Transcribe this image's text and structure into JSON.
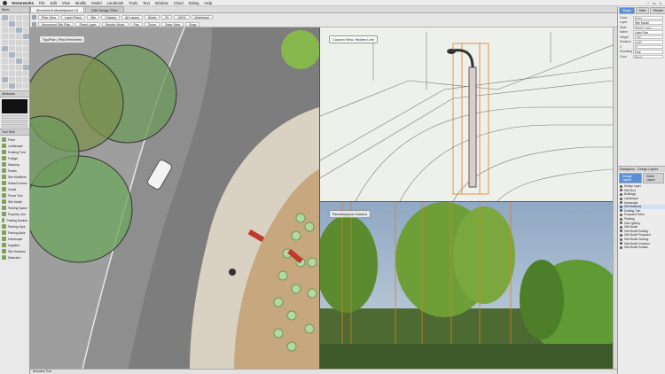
{
  "menu": {
    "app": "Vectorworks",
    "items": [
      "File",
      "Edit",
      "View",
      "Modify",
      "Model",
      "Landmark",
      "Tools",
      "Text",
      "Window",
      "Cloud",
      "Dialog",
      "Help"
    ]
  },
  "tabs": [
    {
      "label": "Monument Marketplace v4"
    },
    {
      "label": "Site Design Plan"
    }
  ],
  "viewbar": {
    "row1": [
      "Plan View",
      "Layer Plane",
      "Site",
      "Classes",
      "All Layers",
      "Sheet",
      "Fit",
      "100%",
      "Wireframe"
    ],
    "row2": [
      "Monument Site Plan",
      "Sheet Layer",
      "Render Mode",
      "Pan",
      "Zoom",
      "Save View",
      "Snap"
    ]
  },
  "tools_palette": {
    "title": "Basic",
    "attributes_title": "Attributes",
    "toolsets_title": "Tool Sets",
    "toolset_items": [
      "Plant",
      "Landscape",
      "Existing Tree",
      "Foliage",
      "Massing",
      "Roads",
      "Site Modifiers",
      "Stake/Contour",
      "Grade",
      "Fence Tool",
      "Site Model",
      "Parking Space",
      "Property Line",
      "Parking Module",
      "Parking Spot",
      "Parking Aisle",
      "Hardscape",
      "Irrigation",
      "Site Sections",
      "Detection"
    ]
  },
  "viewports": {
    "plan_label": "Top/Plan, Plan Rendered",
    "wire_label": "Custom View, Hidden Line",
    "render_label": "Renderworks Camera"
  },
  "object_info": {
    "tabs": [
      "Shape",
      "Data",
      "Render"
    ],
    "fields": [
      {
        "k": "Class",
        "v": "None"
      },
      {
        "k": "Layer",
        "v": "Site Model"
      },
      {
        "k": "Style",
        "v": "Street Lamp"
      },
      {
        "k": "Name",
        "v": "Light Pole"
      },
      {
        "k": "Height",
        "v": "12'0\""
      },
      {
        "k": "Rotation",
        "v": "0.00°"
      },
      {
        "k": "Z",
        "v": "0\""
      },
      {
        "k": "Mounting",
        "v": "Pole"
      },
      {
        "k": "Color",
        "v": "Black"
      }
    ]
  },
  "navigation": {
    "title": "Navigation - Design Layers",
    "tabs": [
      "Design Layers",
      "Sheet Layers"
    ],
    "rows": [
      "Design Layer",
      "Site Mod",
      "Buildings",
      "Landscape",
      "Hardscape",
      "Site Materials",
      "Existing Tree",
      "Proposed Trees",
      "Planting",
      "Site Lighting",
      "Site Model",
      "Site Model Existing",
      "Site Model Proposed",
      "Site Model Grading",
      "Site Model Contours",
      "Site Model Surface"
    ],
    "selected_index": 5
  },
  "status": {
    "text": "Selection Tool"
  }
}
